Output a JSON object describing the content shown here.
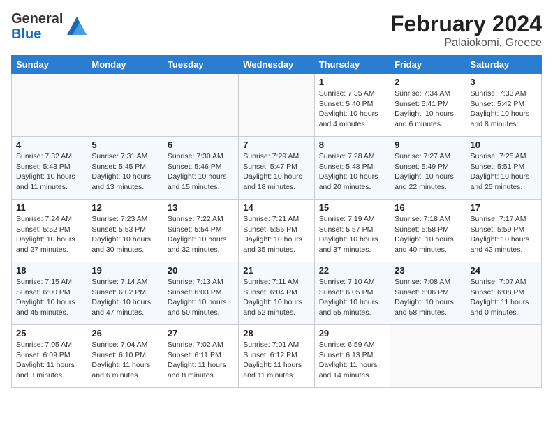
{
  "header": {
    "logo_line1": "General",
    "logo_line2": "Blue",
    "title": "February 2024",
    "subtitle": "Palaiokomi, Greece"
  },
  "days_of_week": [
    "Sunday",
    "Monday",
    "Tuesday",
    "Wednesday",
    "Thursday",
    "Friday",
    "Saturday"
  ],
  "weeks": [
    [
      {
        "num": "",
        "info": ""
      },
      {
        "num": "",
        "info": ""
      },
      {
        "num": "",
        "info": ""
      },
      {
        "num": "",
        "info": ""
      },
      {
        "num": "1",
        "info": "Sunrise: 7:35 AM\nSunset: 5:40 PM\nDaylight: 10 hours\nand 4 minutes."
      },
      {
        "num": "2",
        "info": "Sunrise: 7:34 AM\nSunset: 5:41 PM\nDaylight: 10 hours\nand 6 minutes."
      },
      {
        "num": "3",
        "info": "Sunrise: 7:33 AM\nSunset: 5:42 PM\nDaylight: 10 hours\nand 8 minutes."
      }
    ],
    [
      {
        "num": "4",
        "info": "Sunrise: 7:32 AM\nSunset: 5:43 PM\nDaylight: 10 hours\nand 11 minutes."
      },
      {
        "num": "5",
        "info": "Sunrise: 7:31 AM\nSunset: 5:45 PM\nDaylight: 10 hours\nand 13 minutes."
      },
      {
        "num": "6",
        "info": "Sunrise: 7:30 AM\nSunset: 5:46 PM\nDaylight: 10 hours\nand 15 minutes."
      },
      {
        "num": "7",
        "info": "Sunrise: 7:29 AM\nSunset: 5:47 PM\nDaylight: 10 hours\nand 18 minutes."
      },
      {
        "num": "8",
        "info": "Sunrise: 7:28 AM\nSunset: 5:48 PM\nDaylight: 10 hours\nand 20 minutes."
      },
      {
        "num": "9",
        "info": "Sunrise: 7:27 AM\nSunset: 5:49 PM\nDaylight: 10 hours\nand 22 minutes."
      },
      {
        "num": "10",
        "info": "Sunrise: 7:25 AM\nSunset: 5:51 PM\nDaylight: 10 hours\nand 25 minutes."
      }
    ],
    [
      {
        "num": "11",
        "info": "Sunrise: 7:24 AM\nSunset: 5:52 PM\nDaylight: 10 hours\nand 27 minutes."
      },
      {
        "num": "12",
        "info": "Sunrise: 7:23 AM\nSunset: 5:53 PM\nDaylight: 10 hours\nand 30 minutes."
      },
      {
        "num": "13",
        "info": "Sunrise: 7:22 AM\nSunset: 5:54 PM\nDaylight: 10 hours\nand 32 minutes."
      },
      {
        "num": "14",
        "info": "Sunrise: 7:21 AM\nSunset: 5:56 PM\nDaylight: 10 hours\nand 35 minutes."
      },
      {
        "num": "15",
        "info": "Sunrise: 7:19 AM\nSunset: 5:57 PM\nDaylight: 10 hours\nand 37 minutes."
      },
      {
        "num": "16",
        "info": "Sunrise: 7:18 AM\nSunset: 5:58 PM\nDaylight: 10 hours\nand 40 minutes."
      },
      {
        "num": "17",
        "info": "Sunrise: 7:17 AM\nSunset: 5:59 PM\nDaylight: 10 hours\nand 42 minutes."
      }
    ],
    [
      {
        "num": "18",
        "info": "Sunrise: 7:15 AM\nSunset: 6:00 PM\nDaylight: 10 hours\nand 45 minutes."
      },
      {
        "num": "19",
        "info": "Sunrise: 7:14 AM\nSunset: 6:02 PM\nDaylight: 10 hours\nand 47 minutes."
      },
      {
        "num": "20",
        "info": "Sunrise: 7:13 AM\nSunset: 6:03 PM\nDaylight: 10 hours\nand 50 minutes."
      },
      {
        "num": "21",
        "info": "Sunrise: 7:11 AM\nSunset: 6:04 PM\nDaylight: 10 hours\nand 52 minutes."
      },
      {
        "num": "22",
        "info": "Sunrise: 7:10 AM\nSunset: 6:05 PM\nDaylight: 10 hours\nand 55 minutes."
      },
      {
        "num": "23",
        "info": "Sunrise: 7:08 AM\nSunset: 6:06 PM\nDaylight: 10 hours\nand 58 minutes."
      },
      {
        "num": "24",
        "info": "Sunrise: 7:07 AM\nSunset: 6:08 PM\nDaylight: 11 hours\nand 0 minutes."
      }
    ],
    [
      {
        "num": "25",
        "info": "Sunrise: 7:05 AM\nSunset: 6:09 PM\nDaylight: 11 hours\nand 3 minutes."
      },
      {
        "num": "26",
        "info": "Sunrise: 7:04 AM\nSunset: 6:10 PM\nDaylight: 11 hours\nand 6 minutes."
      },
      {
        "num": "27",
        "info": "Sunrise: 7:02 AM\nSunset: 6:11 PM\nDaylight: 11 hours\nand 8 minutes."
      },
      {
        "num": "28",
        "info": "Sunrise: 7:01 AM\nSunset: 6:12 PM\nDaylight: 11 hours\nand 11 minutes."
      },
      {
        "num": "29",
        "info": "Sunrise: 6:59 AM\nSunset: 6:13 PM\nDaylight: 11 hours\nand 14 minutes."
      },
      {
        "num": "",
        "info": ""
      },
      {
        "num": "",
        "info": ""
      }
    ]
  ]
}
